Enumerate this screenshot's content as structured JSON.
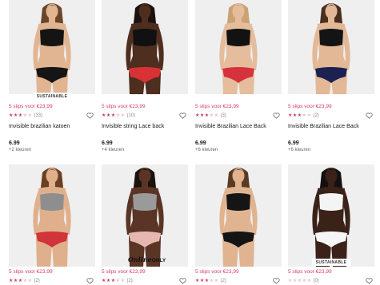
{
  "colors": {
    "promo": "#d93b6c",
    "star_on": "#c73d6c",
    "star_off": "#e8c1ce",
    "photo_bg": "#efefef"
  },
  "products": [
    {
      "promo": "5 slips voor €23,99",
      "stars": 3,
      "reviews": "(33)",
      "title": "Invisible brazilian katoen",
      "price": "6.99",
      "colors": "+2 kleuren",
      "badge": "SUSTAINABLE",
      "skin": "#e2b592",
      "hair": "#6b4528",
      "top": "#141414",
      "bottom": "#151515"
    },
    {
      "promo": "5 slips voor €23,99",
      "stars": 3,
      "reviews": "(10)",
      "title": "Invisible string Lace back",
      "price": "6.99",
      "colors": "+4 kleuren",
      "badge": "",
      "skin": "#4e2e1f",
      "hair": "#1b1210",
      "top": "#111111",
      "bottom": "#d93236"
    },
    {
      "promo": "5 slips voor €23,99",
      "stars": 3,
      "reviews": "(3)",
      "title": "Invisible Brazilian Lace Back",
      "price": "6.99",
      "colors": "+6 kleuren",
      "badge": "",
      "skin": "#e6bd9c",
      "hair": "#c9a371",
      "top": "#121212",
      "bottom": "#d6323d"
    },
    {
      "promo": "5 slips voor €23,99",
      "stars": 3,
      "reviews": "(2)",
      "title": "Invisible Brazilian Lace Back",
      "price": "6.99",
      "colors": "+6 kleuren",
      "badge": "",
      "skin": "#e3b897",
      "hair": "#4a2f1e",
      "top": "#141414",
      "bottom": "#1b2150"
    },
    {
      "promo": "5 slips voor €23,99",
      "stars": 3,
      "reviews": "(2)",
      "title": "",
      "price": "",
      "colors": "",
      "badge": "",
      "skin": "#e0b08c",
      "hair": "#6a3f24",
      "top": "#8e8e8e",
      "bottom": "#d1343a"
    },
    {
      "promo": "5 slips voor €23,99",
      "stars": 3,
      "reviews": "(2)",
      "title": "",
      "price": "",
      "colors": "",
      "badge": "",
      "logo": "Online ONLY",
      "skin": "#5a3526",
      "hair": "#1a1210",
      "top": "#9a9a9a",
      "bottom": "#e5b7b0"
    },
    {
      "promo": "5 slips voor €23,99",
      "stars": 3,
      "reviews": "(2)",
      "title": "",
      "price": "",
      "colors": "",
      "badge": "",
      "skin": "#e0b391",
      "hair": "#5b3a24",
      "top": "#151515",
      "bottom": "#141414"
    },
    {
      "promo": "5 slips voor €23,99",
      "stars": 0,
      "reviews": "(0)",
      "title": "",
      "price": "",
      "colors": "",
      "badge": "SUSTAINABLE",
      "skin": "#3a2218",
      "hair": "#141010",
      "top": "#f4f4f4",
      "bottom": "#f6f6f6"
    }
  ]
}
